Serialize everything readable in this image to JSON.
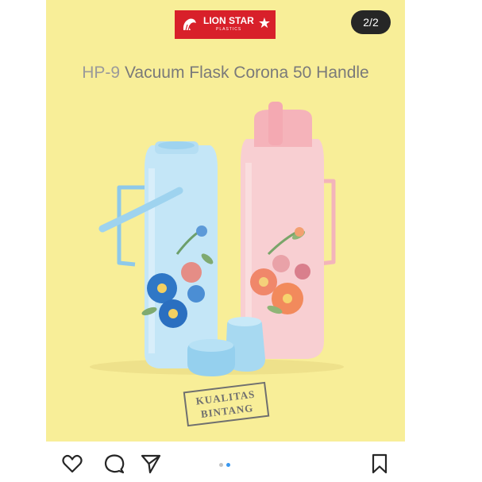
{
  "carousel": {
    "counter": "2/2",
    "current_index": 2,
    "total": 2
  },
  "brand": {
    "name": "LION STAR",
    "sub": "PLASTICS",
    "color": "#d8202a"
  },
  "product": {
    "model": "HP-9",
    "name": "Vacuum Flask Corona 50 Handle",
    "background": "#f8ee98",
    "flask_colors": [
      "#bfe3f4",
      "#f7c9cb"
    ]
  },
  "stamp": {
    "line1": "KUALITAS",
    "line2": "BINTANG"
  },
  "actions": {
    "icons": [
      "heart-icon",
      "comment-icon",
      "share-icon",
      "bookmark-icon"
    ],
    "active_dot_color": "#3897f0",
    "inactive_dot_color": "#c4c4c4"
  }
}
